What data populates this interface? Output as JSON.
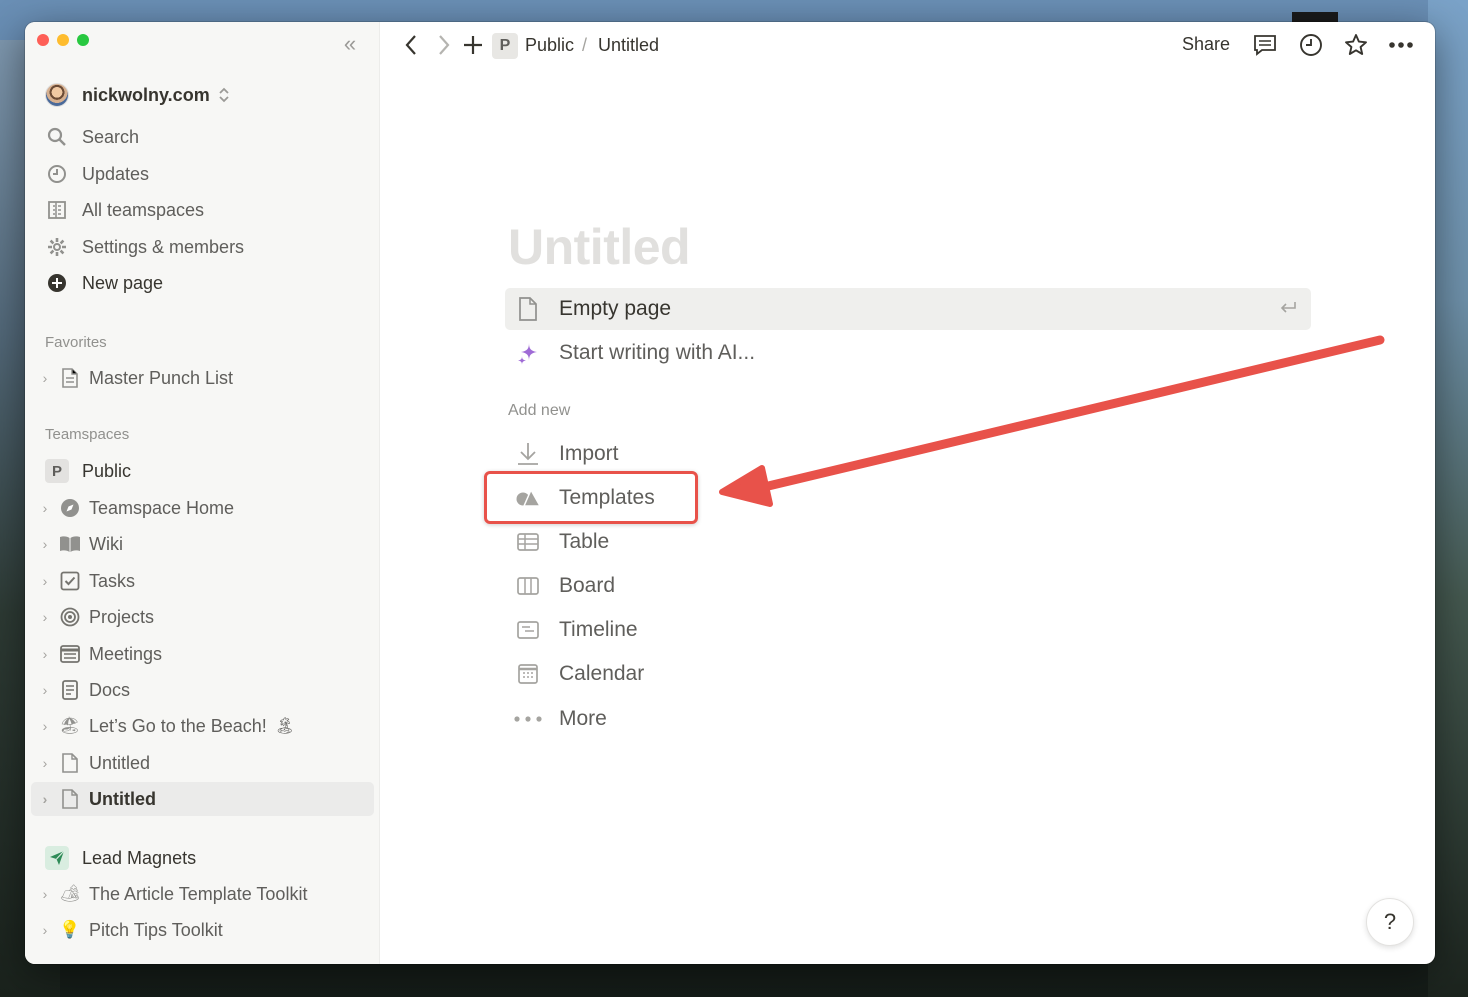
{
  "sidebar": {
    "workspace_name": "nickwolny.com",
    "nav": [
      {
        "label": "Search",
        "icon": "search-icon"
      },
      {
        "label": "Updates",
        "icon": "clock-icon"
      },
      {
        "label": "All teamspaces",
        "icon": "building-icon"
      },
      {
        "label": "Settings & members",
        "icon": "gear-icon"
      },
      {
        "label": "New page",
        "icon": "plus-circle-icon"
      }
    ],
    "favorites_label": "Favorites",
    "favorites": [
      {
        "label": "Master Punch List",
        "icon": "document-icon"
      }
    ],
    "teamspaces_label": "Teamspaces",
    "teamspace": {
      "badge": "P",
      "name": "Public"
    },
    "pages": [
      {
        "label": "Teamspace Home",
        "icon": "compass-icon"
      },
      {
        "label": "Wiki",
        "icon": "book-icon"
      },
      {
        "label": "Tasks",
        "icon": "checkbox-icon"
      },
      {
        "label": "Projects",
        "icon": "target-icon"
      },
      {
        "label": "Meetings",
        "icon": "calendar-list-icon"
      },
      {
        "label": "Docs",
        "icon": "doc-lines-icon"
      },
      {
        "label": "Let’s Go to the Beach!",
        "icon": "beach-umbrella-emoji",
        "emoji": "🏖",
        "trailing_emoji": "🏝"
      },
      {
        "label": "Untitled",
        "icon": "document-icon"
      },
      {
        "label": "Untitled",
        "icon": "document-icon",
        "active": true
      }
    ],
    "lead_magnets": {
      "name": "Lead Magnets",
      "icon": "paper-plane-icon"
    },
    "lead_pages": [
      {
        "label": "The Article Template Toolkit",
        "emoji": "🏕",
        "icon": "camping-emoji"
      },
      {
        "label": "Pitch Tips Toolkit",
        "emoji": "💡",
        "icon": "lightbulb-emoji"
      }
    ]
  },
  "topbar": {
    "breadcrumb_badge": "P",
    "breadcrumb_1": "Public",
    "breadcrumb_sep": "/",
    "breadcrumb_2": "Untitled",
    "share_label": "Share"
  },
  "main": {
    "title_placeholder": "Untitled",
    "empty_page": "Empty page",
    "ai_writing": "Start writing with AI...",
    "add_new_label": "Add new",
    "add_new_items": [
      {
        "label": "Import",
        "icon": "download-icon"
      },
      {
        "label": "Templates",
        "icon": "shapes-icon"
      },
      {
        "label": "Table",
        "icon": "table-icon"
      },
      {
        "label": "Board",
        "icon": "board-icon"
      },
      {
        "label": "Timeline",
        "icon": "timeline-icon"
      },
      {
        "label": "Calendar",
        "icon": "calendar-icon"
      },
      {
        "label": "More",
        "icon": "more-dots-icon"
      }
    ]
  },
  "help_label": "?",
  "colors": {
    "annotation": "#e8524a",
    "sidebar_bg": "#f7f7f5",
    "text": "#37352f",
    "muted": "#91918e"
  }
}
